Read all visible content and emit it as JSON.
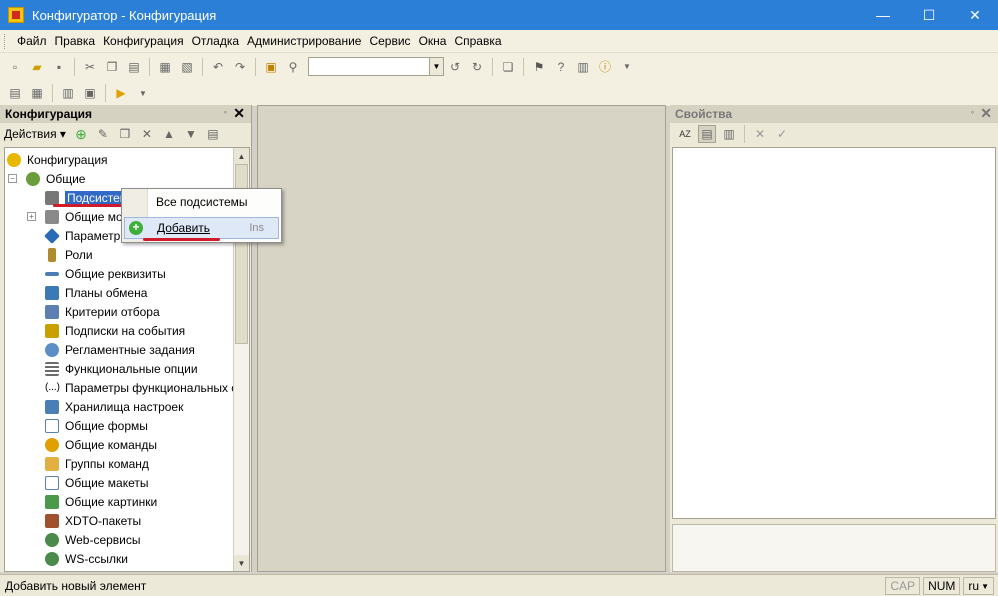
{
  "window": {
    "title": "Конфигуратор - Конфигурация",
    "minimize": "—",
    "maximize": "☐",
    "close": "✕"
  },
  "menu": [
    "Файл",
    "Правка",
    "Конфигурация",
    "Отладка",
    "Администрирование",
    "Сервис",
    "Окна",
    "Справка"
  ],
  "left_panel": {
    "title": "Конфигурация",
    "actions_label": "Действия ▾",
    "tree": [
      {
        "label": "Конфигурация",
        "icon": "config-icon",
        "color": "#e8b800"
      },
      {
        "label": "Общие",
        "icon": "common-icon",
        "color": "#6a9e3a"
      },
      {
        "label": "Подсистемы",
        "icon": "subsystems-icon",
        "color": "#666666"
      },
      {
        "label": "Общие модули",
        "icon": "modules-icon",
        "color": "#7b7b7b"
      },
      {
        "label": "Параметры сеанса",
        "icon": "params-icon",
        "color": "#2a6bb5"
      },
      {
        "label": "Роли",
        "icon": "roles-icon",
        "color": "#b08a2e"
      },
      {
        "label": "Общие реквизиты",
        "icon": "attributes-icon",
        "color": "#4a7fb5"
      },
      {
        "label": "Планы обмена",
        "icon": "exchange-icon",
        "color": "#3a7ab5"
      },
      {
        "label": "Критерии отбора",
        "icon": "criteria-icon",
        "color": "#5a7fb0"
      },
      {
        "label": "Подписки на события",
        "icon": "events-icon",
        "color": "#c8a000"
      },
      {
        "label": "Регламентные задания",
        "icon": "jobs-icon",
        "color": "#5b8fc6"
      },
      {
        "label": "Функциональные опции",
        "icon": "options-icon",
        "color": "#6b6b6b"
      },
      {
        "label": "Параметры функциональных опций",
        "icon": "option-params-icon",
        "color": "#444444"
      },
      {
        "label": "Хранилища настроек",
        "icon": "storage-icon",
        "color": "#4a7fb5"
      },
      {
        "label": "Общие формы",
        "icon": "forms-icon",
        "color": "#5a7fa8"
      },
      {
        "label": "Общие команды",
        "icon": "commands-icon",
        "color": "#e0a000"
      },
      {
        "label": "Группы команд",
        "icon": "command-groups-icon",
        "color": "#e0b040"
      },
      {
        "label": "Общие макеты",
        "icon": "templates-icon",
        "color": "#5a7fa8"
      },
      {
        "label": "Общие картинки",
        "icon": "pictures-icon",
        "color": "#4a9a4a"
      },
      {
        "label": "XDTO-пакеты",
        "icon": "xdto-icon",
        "color": "#a0522d"
      },
      {
        "label": "Web-сервисы",
        "icon": "web-services-icon",
        "color": "#4a8a4a"
      },
      {
        "label": "WS-ссылки",
        "icon": "ws-links-icon",
        "color": "#4a8a4a"
      }
    ]
  },
  "context_menu": {
    "item1": "Все подсистемы",
    "item2": "Добавить",
    "item2_shortcut": "Ins"
  },
  "right_panel": {
    "title": "Свойства"
  },
  "status": {
    "text": "Добавить новый элемент",
    "cap": "CAP",
    "num": "NUM",
    "lang": "ru"
  }
}
